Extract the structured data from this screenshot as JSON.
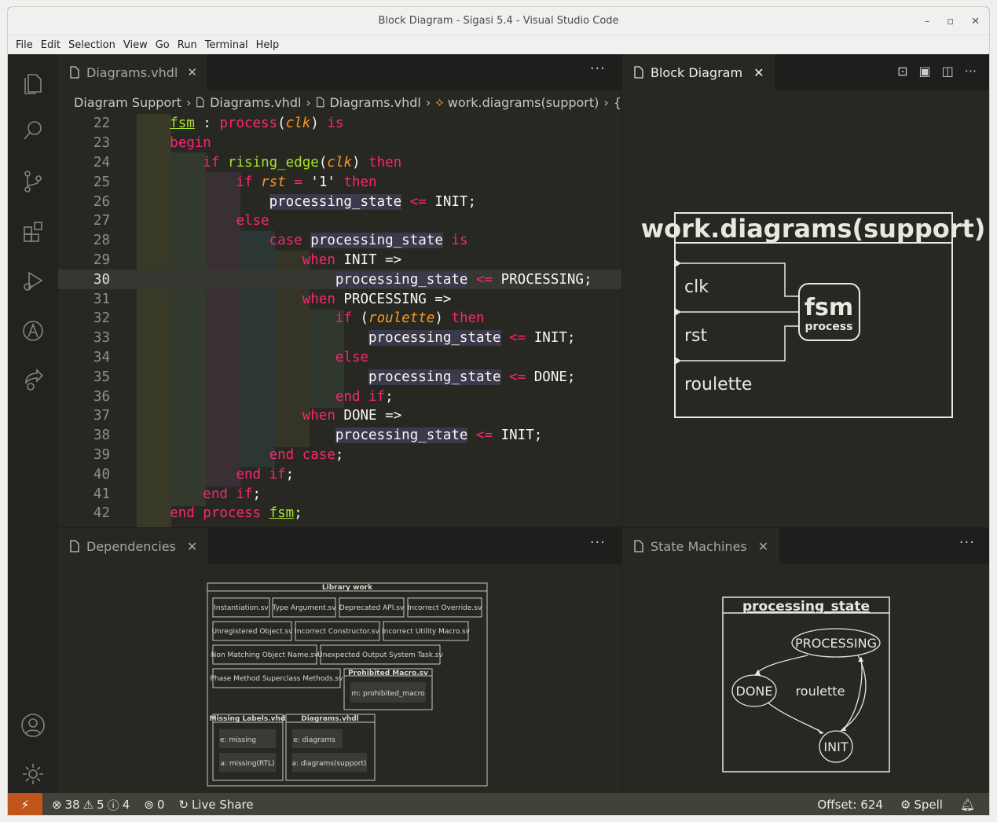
{
  "window": {
    "title": "Block Diagram - Sigasi 5.4 - Visual Studio Code",
    "minimize": "–",
    "maximize": "▫",
    "close": "✕"
  },
  "menu": [
    "File",
    "Edit",
    "Selection",
    "View",
    "Go",
    "Run",
    "Terminal",
    "Help"
  ],
  "activity_icons": [
    "explorer-icon",
    "search-icon",
    "source-control-icon",
    "extensions-icon",
    "run-debug-icon",
    "sigasi-icon",
    "live-share-icon",
    "account-icon",
    "settings-gear-icon"
  ],
  "editor": {
    "tab_label": "Diagrams.vhdl",
    "more": "···",
    "breadcrumb": [
      "Diagram Support",
      "Diagrams.vhdl",
      "Diagrams.vhdl",
      "work.diagrams(support)",
      "{"
    ],
    "current_line": "30",
    "lines": [
      {
        "n": "22"
      },
      {
        "n": "23"
      },
      {
        "n": "24"
      },
      {
        "n": "25"
      },
      {
        "n": "26"
      },
      {
        "n": "27"
      },
      {
        "n": "28"
      },
      {
        "n": "29"
      },
      {
        "n": "30"
      },
      {
        "n": "31"
      },
      {
        "n": "32"
      },
      {
        "n": "33"
      },
      {
        "n": "34"
      },
      {
        "n": "35"
      },
      {
        "n": "36"
      },
      {
        "n": "37"
      },
      {
        "n": "38"
      },
      {
        "n": "39"
      },
      {
        "n": "40"
      },
      {
        "n": "41"
      },
      {
        "n": "42"
      }
    ]
  },
  "block_diagram": {
    "tab_label": "Block Diagram",
    "title": "work.diagrams(support)",
    "ports": [
      "clk",
      "rst",
      "roulette"
    ],
    "process_name": "fsm",
    "process_label": "process"
  },
  "dependencies": {
    "tab_label": "Dependencies",
    "library": "Library work",
    "files": [
      "Instantiation.sv",
      "Type Argument.sv",
      "Deprecated API.sv",
      "Incorrect Override.sv",
      "Unregistered Object.sv",
      "Incorrect Constructor.sv",
      "Incorrect Utility Macro.sv",
      "Non Matching Object Name.sv",
      "Unexpected Output System Task.sv",
      "Phase Method Superclass Methods.sv"
    ],
    "prohibited": {
      "name": "Prohibited Macro.sv",
      "item": "m: prohibited_macro"
    },
    "missing": {
      "name": "Missing Labels.vhd",
      "items": [
        "e: missing",
        "a: missing(RTL)"
      ]
    },
    "diagrams": {
      "name": "Diagrams.vhdl",
      "items": [
        "e: diagrams",
        "a: diagrams(support)"
      ]
    }
  },
  "state_machines": {
    "tab_label": "State Machines",
    "title": "processing_state",
    "states": [
      "PROCESSING",
      "DONE",
      "INIT"
    ],
    "transition_label": "roulette"
  },
  "status": {
    "errors": "38",
    "warnings": "5",
    "infos": "4",
    "ports": "0",
    "live_share": "Live Share",
    "offset": "Offset: 624",
    "spell": "Spell"
  }
}
